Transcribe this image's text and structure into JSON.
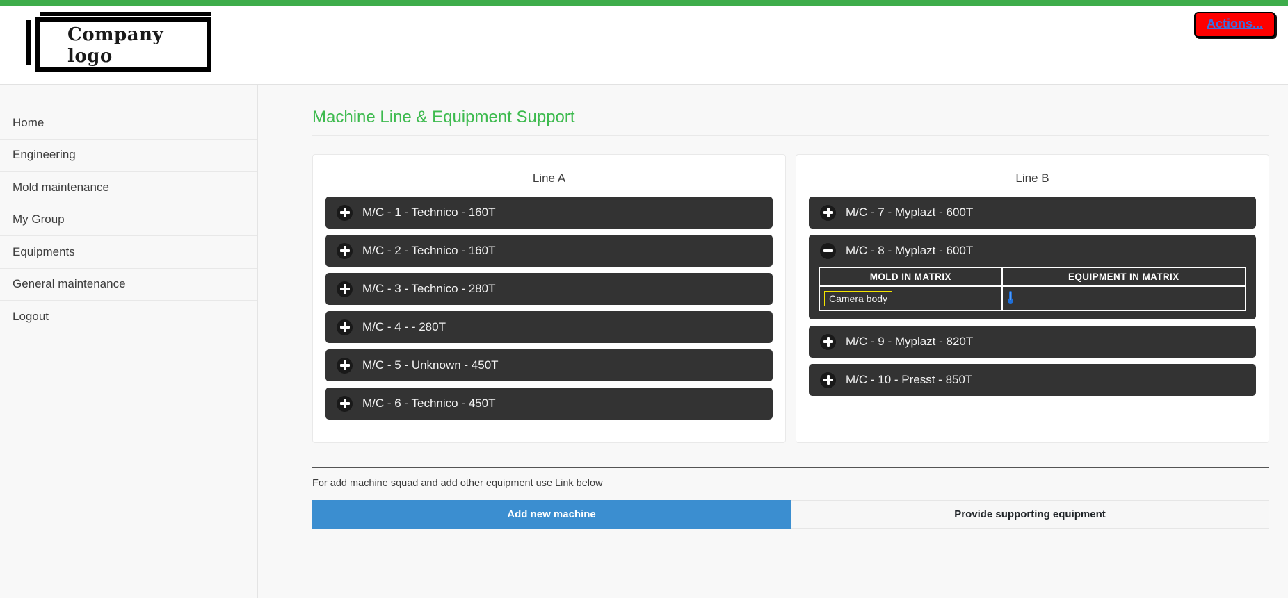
{
  "theme": {
    "top_bar_color": "#3ead4b",
    "title_color": "#3dba4e",
    "machine_bg": "#333333",
    "actions_bg": "#fe0000",
    "actions_text_color": "#3a6ee0",
    "primary_button_color": "#3b8ed0",
    "chip_border_color": "#f2e400",
    "thermometer_color": "#1e6fd9"
  },
  "header": {
    "logo_text": "Company logo",
    "actions_label": "Actions..."
  },
  "sidebar": {
    "items": [
      {
        "label": "Home"
      },
      {
        "label": "Engineering"
      },
      {
        "label": "Mold maintenance"
      },
      {
        "label": "My Group"
      },
      {
        "label": "Equipments"
      },
      {
        "label": "General maintenance"
      },
      {
        "label": "Logout"
      }
    ]
  },
  "main": {
    "page_title": "Machine Line & Equipment Support",
    "lines": [
      {
        "title": "Line A",
        "machines": [
          {
            "label": "M/C - 1 - Technico - 160T",
            "expanded": false,
            "icon": "plus-icon"
          },
          {
            "label": "M/C - 2 - Technico - 160T",
            "expanded": false,
            "icon": "plus-icon"
          },
          {
            "label": "M/C - 3 - Technico - 280T",
            "expanded": false,
            "icon": "plus-icon"
          },
          {
            "label": "M/C - 4 - - 280T",
            "expanded": false,
            "icon": "plus-icon"
          },
          {
            "label": "M/C - 5 - Unknown - 450T",
            "expanded": false,
            "icon": "plus-icon"
          },
          {
            "label": "M/C - 6 - Technico - 450T",
            "expanded": false,
            "icon": "plus-icon"
          }
        ]
      },
      {
        "title": "Line B",
        "machines": [
          {
            "label": "M/C - 7 - Myplazt - 600T",
            "expanded": false,
            "icon": "plus-icon"
          },
          {
            "label": "M/C - 8 - Myplazt - 600T",
            "expanded": true,
            "icon": "minus-icon",
            "matrix": {
              "headers": [
                "MOLD IN MATRIX",
                "EQUIPMENT IN MATRIX"
              ],
              "rows": [
                {
                  "mold": "Camera body",
                  "equipment_icon": "thermometer-icon"
                }
              ]
            }
          },
          {
            "label": "M/C - 9 - Myplazt - 820T",
            "expanded": false,
            "icon": "plus-icon"
          },
          {
            "label": "M/C - 10 - Presst - 850T",
            "expanded": false,
            "icon": "plus-icon"
          }
        ]
      }
    ]
  },
  "footer": {
    "note": "For add machine squad and add other equipment use Link below",
    "add_machine_label": "Add new machine",
    "provide_equipment_label": "Provide supporting equipment"
  }
}
